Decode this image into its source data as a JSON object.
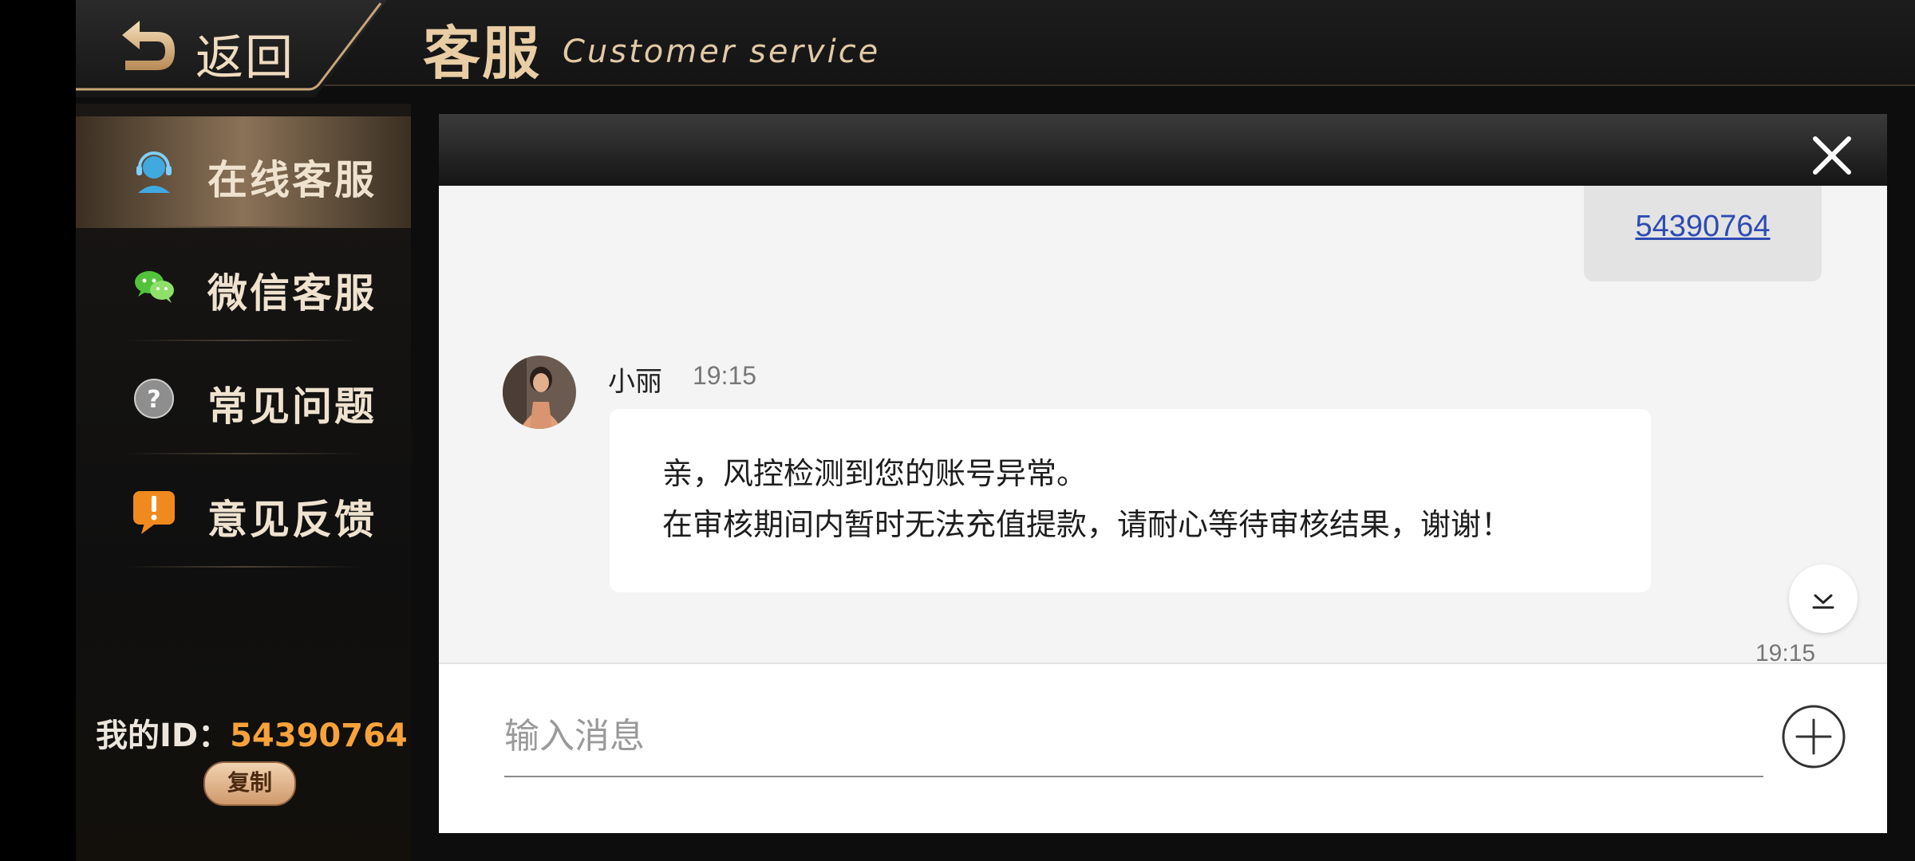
{
  "header": {
    "back_label": "返回",
    "title": "客服",
    "subtitle": "Customer service"
  },
  "sidebar": {
    "items": [
      {
        "label": "在线客服",
        "icon": "headset-icon",
        "active": true
      },
      {
        "label": "微信客服",
        "icon": "wechat-icon",
        "active": false
      },
      {
        "label": "常见问题",
        "icon": "question-icon",
        "active": false
      },
      {
        "label": "意见反馈",
        "icon": "feedback-icon",
        "active": false
      }
    ],
    "my_id_label": "我的ID：",
    "my_id_value": "54390764",
    "copy_label": "复制"
  },
  "chat": {
    "my_message": {
      "text": "54390764"
    },
    "agent_message": {
      "name": "小丽",
      "time": "19:15",
      "line1": "亲，风控检测到您的账号异常。",
      "line2": "在审核期间内暂时无法充值提款，请耐心等待审核结果，谢谢！"
    },
    "bottom_time": "19:15",
    "input_placeholder": "输入消息"
  },
  "colors": {
    "accent_gold": "#e9cda5",
    "id_orange": "#f7a23a",
    "link_blue": "#2e4bb3"
  }
}
